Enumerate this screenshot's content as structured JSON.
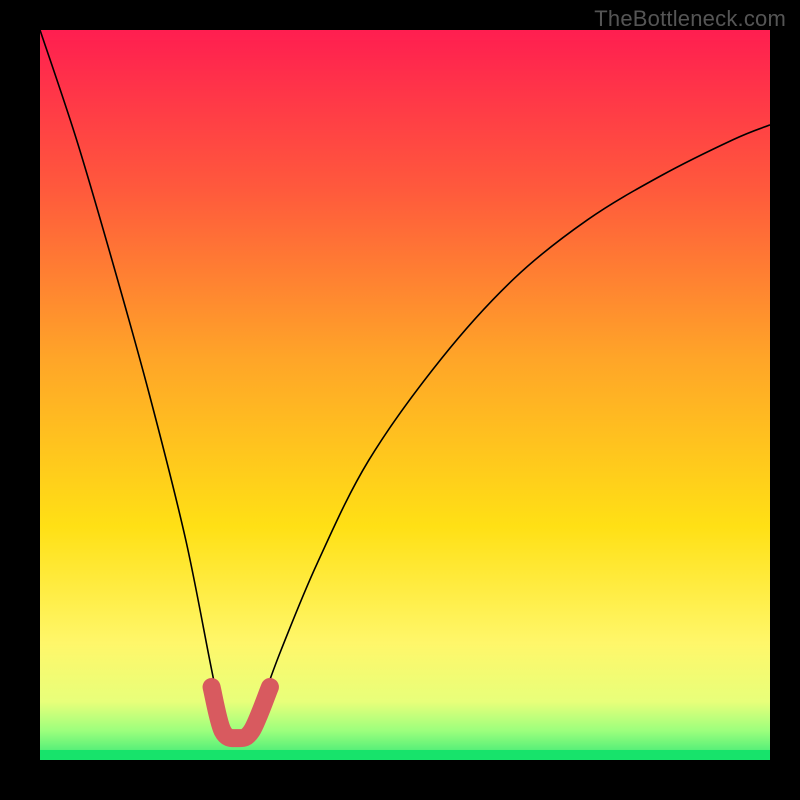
{
  "watermark": "TheBottleneck.com",
  "colors": {
    "bg_top": "#ff1e50",
    "bg_mid1": "#ff7a32",
    "bg_mid2": "#ffd21e",
    "bg_low": "#fff76a",
    "bg_pale_green": "#bfff8c",
    "bg_green": "#17e36b",
    "curve": "#000000",
    "highlight": "#d85a5f",
    "frame": "#000000"
  },
  "chart_data": {
    "type": "line",
    "title": "",
    "xlabel": "",
    "ylabel": "",
    "xlim": [
      0,
      100
    ],
    "ylim": [
      0,
      100
    ],
    "legend": false,
    "grid": false,
    "background": "vertical-gradient red→orange→yellow→green",
    "series": [
      {
        "name": "bottleneck-curve",
        "description": "V-shaped curve; steep descent from top-left to a minimum near x≈27, then gradual rise toward the right edge.",
        "x": [
          0,
          5,
          10,
          15,
          20,
          24,
          26,
          28,
          30,
          33,
          38,
          45,
          55,
          65,
          75,
          85,
          95,
          100
        ],
        "values": [
          100,
          85,
          68,
          50,
          30,
          10,
          3,
          3,
          7,
          15,
          27,
          41,
          55,
          66,
          74,
          80,
          85,
          87
        ]
      },
      {
        "name": "optimal-highlight",
        "description": "Thick pink/red U-shaped marker at the valley of the curve indicating the optimal / non-bottlenecked zone.",
        "x": [
          23.5,
          25,
          27,
          29,
          31.5
        ],
        "values": [
          10,
          4,
          3,
          4,
          10
        ]
      }
    ],
    "annotations": []
  }
}
